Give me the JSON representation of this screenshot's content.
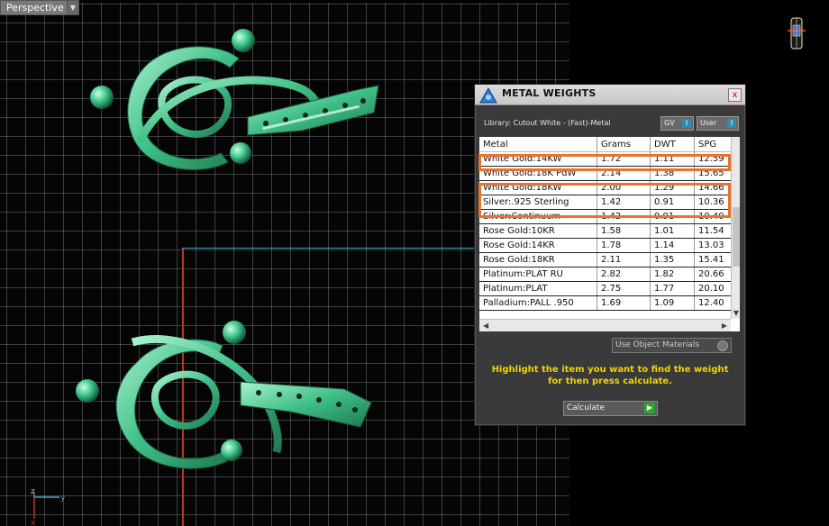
{
  "viewport": {
    "label": "Perspective",
    "axis_labels": {
      "z": "z",
      "y": "y",
      "x": "x"
    }
  },
  "panel": {
    "title": "METAL WEIGHTS",
    "close": "x",
    "library_label": "Library: Cutout White - (Fast)-Metal",
    "gv_label": "GV",
    "user_label": "User",
    "columns": [
      "Metal",
      "Grams",
      "DWT",
      "SPG"
    ],
    "rows": [
      [
        "White Gold:14KW",
        "1.72",
        "1.11",
        "12.59"
      ],
      [
        "White Gold:18K PdW",
        "2.14",
        "1.38",
        "15.65"
      ],
      [
        "White Gold:18KW",
        "2.00",
        "1.29",
        "14.66"
      ],
      [
        "Silver:.925 Sterling",
        "1.42",
        "0.91",
        "10.36"
      ],
      [
        "Silver:Continuum",
        "1.42",
        "0.91",
        "10.40"
      ],
      [
        "Rose Gold:10KR",
        "1.58",
        "1.01",
        "11.54"
      ],
      [
        "Rose Gold:14KR",
        "1.78",
        "1.14",
        "13.03"
      ],
      [
        "Rose Gold:18KR",
        "2.11",
        "1.35",
        "15.41"
      ],
      [
        "Platinum:PLAT RU",
        "2.82",
        "1.82",
        "20.66"
      ],
      [
        "Platinum:PLAT",
        "2.75",
        "1.77",
        "20.10"
      ],
      [
        "Palladium:PALL .950",
        "1.69",
        "1.09",
        "12.40"
      ]
    ],
    "use_object_materials": "Use Object Materials",
    "hint_line1": "Highlight the item you want to find the weight",
    "hint_line2": "for then press calculate.",
    "calculate_label": "Calculate"
  },
  "colors": {
    "highlight": "#e8732c",
    "hint": "#f1d200",
    "ring": "#4fd39a"
  }
}
